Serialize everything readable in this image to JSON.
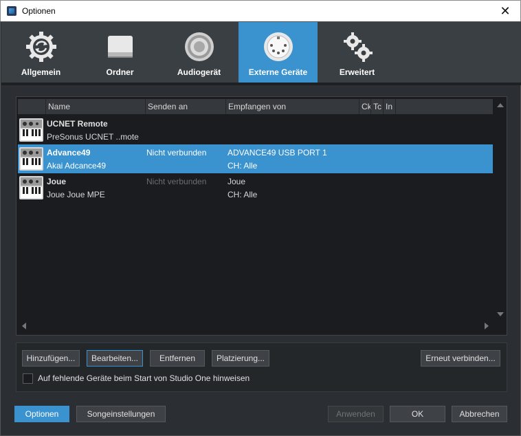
{
  "window": {
    "title": "Optionen"
  },
  "tabs": [
    {
      "label": "Allgemein",
      "icon": "gear-refresh-icon"
    },
    {
      "label": "Ordner",
      "icon": "drive-icon"
    },
    {
      "label": "Audiogerät",
      "icon": "speaker-icon"
    },
    {
      "label": "Externe Geräte",
      "icon": "midi-port-icon"
    },
    {
      "label": "Erweitert",
      "icon": "gears-icon"
    }
  ],
  "table": {
    "columns": [
      "Name",
      "Senden an",
      "Empfangen von",
      "Ck",
      "Tc",
      "In"
    ],
    "rows": [
      {
        "name": "UCNET Remote",
        "model": "PreSonus UCNET ..mote",
        "send": "",
        "receive": "",
        "channel": ""
      },
      {
        "name": "Advance49",
        "model": "Akai Adcance49",
        "send": "Nicht verbunden",
        "receive": "ADVANCE49 USB PORT 1",
        "channel": "CH: Alle"
      },
      {
        "name": "Joue",
        "model": "Joue Joue MPE",
        "send": "Nicht verbunden",
        "receive": "Joue",
        "channel": "CH: Alle"
      }
    ]
  },
  "buttons": {
    "add": "Hinzufügen...",
    "edit": "Bearbeiten...",
    "remove": "Entfernen",
    "placement": "Platzierung...",
    "reconnect": "Erneut verbinden..."
  },
  "checkbox": {
    "label": "Auf fehlende Geräte beim Start von Studio One hinweisen"
  },
  "footer": {
    "options": "Optionen",
    "song_settings": "Songeinstellungen",
    "apply": "Anwenden",
    "ok": "OK",
    "cancel": "Abbrechen"
  },
  "colors": {
    "accent": "#3a92cf",
    "background": "#2b2f33"
  }
}
